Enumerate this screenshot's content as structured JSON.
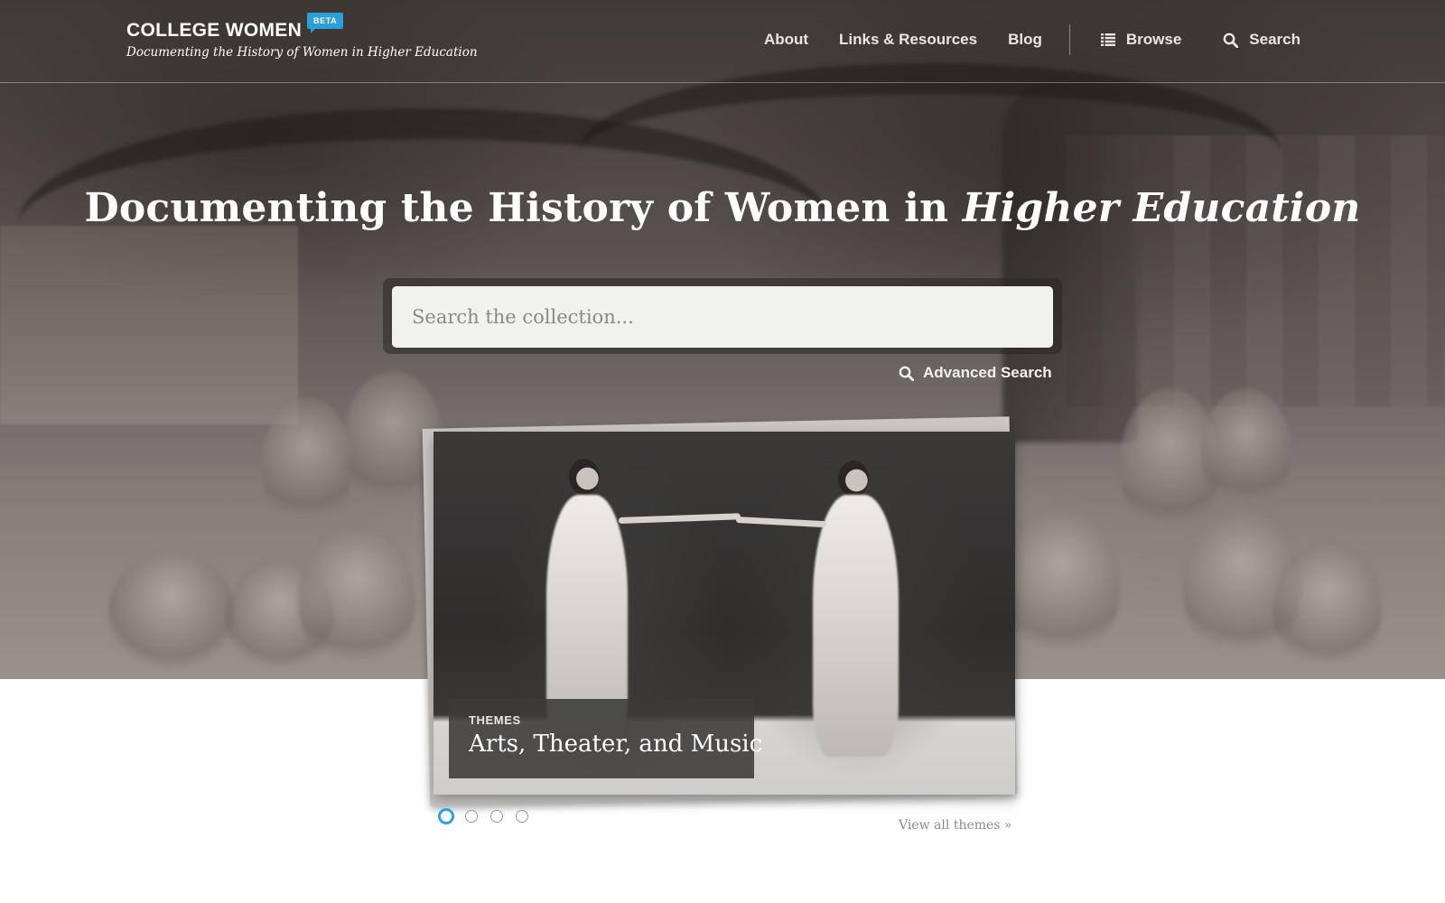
{
  "site": {
    "title": "COLLEGE WOMEN",
    "badge": "BETA",
    "tagline": "Documenting the History of Women in Higher Education"
  },
  "nav": {
    "items": [
      {
        "label": "About"
      },
      {
        "label": "Links & Resources"
      },
      {
        "label": "Blog"
      }
    ],
    "browse_label": "Browse",
    "search_label": "Search",
    "browse_icon": "list-icon",
    "search_icon": "search-icon"
  },
  "hero": {
    "title_plain": "Documenting the History of Women in ",
    "title_emphasis": "Higher Education"
  },
  "search": {
    "placeholder": "Search the collection...",
    "value": "",
    "advanced_label": "Advanced Search"
  },
  "featured": {
    "kicker": "THEMES",
    "title": "Arts, Theater, and Music"
  },
  "carousel": {
    "total": 4,
    "active_index": 0,
    "view_all_label": "View all themes »"
  },
  "colors": {
    "accent": "#2aa3e0",
    "badge": "#2b9fd8",
    "text_light": "#ffffff",
    "muted": "#8e8a87"
  }
}
